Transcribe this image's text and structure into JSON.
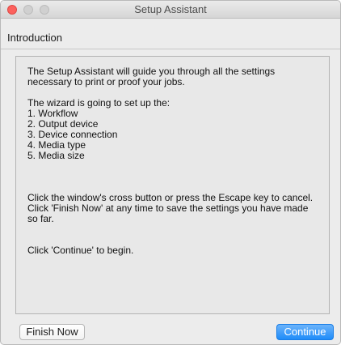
{
  "window": {
    "title": "Setup Assistant"
  },
  "header": {
    "title": "Introduction"
  },
  "content": {
    "intro": "The Setup Assistant will guide you through all the settings necessary to print or proof your jobs.",
    "list_heading": "The wizard is going to set up the:",
    "steps": [
      "1. Workflow",
      "2. Output device",
      "3. Device connection",
      "4. Media type",
      "5. Media size"
    ],
    "cancel_text": "Click the window's cross button or press the Escape key to cancel.",
    "finish_text": "Click 'Finish Now' at any time to save the settings you have made so far.",
    "begin_text": "Click 'Continue' to begin."
  },
  "buttons": {
    "finish_now": "Finish Now",
    "continue": "Continue"
  },
  "colors": {
    "close_button": "#fc615d",
    "accent_button": "#1f8cf9"
  }
}
